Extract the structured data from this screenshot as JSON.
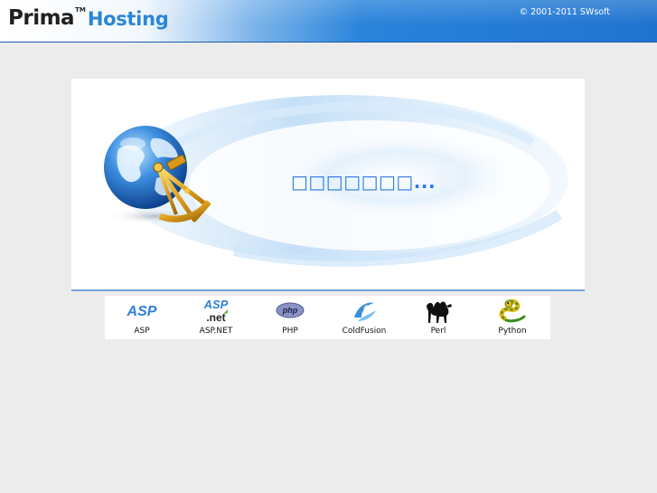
{
  "header": {
    "logo_prima": "Prima",
    "logo_tm": "TM",
    "logo_hosting": "Hosting",
    "copyright": "© 2001-2011 SWsoft"
  },
  "main": {
    "status_text": "□□□□□□□..."
  },
  "technologies": [
    {
      "label": "ASP",
      "icon": "asp-icon"
    },
    {
      "label": "ASP.NET",
      "icon": "aspnet-icon"
    },
    {
      "label": "PHP",
      "icon": "php-icon"
    },
    {
      "label": "ColdFusion",
      "icon": "coldfusion-icon"
    },
    {
      "label": "Perl",
      "icon": "perl-camel-icon"
    },
    {
      "label": "Python",
      "icon": "python-snake-icon"
    }
  ],
  "colors": {
    "header_blue": "#1f73cf",
    "status_text": "#2b7be3",
    "page_background": "#ececec",
    "divider": "#74a8dd"
  }
}
